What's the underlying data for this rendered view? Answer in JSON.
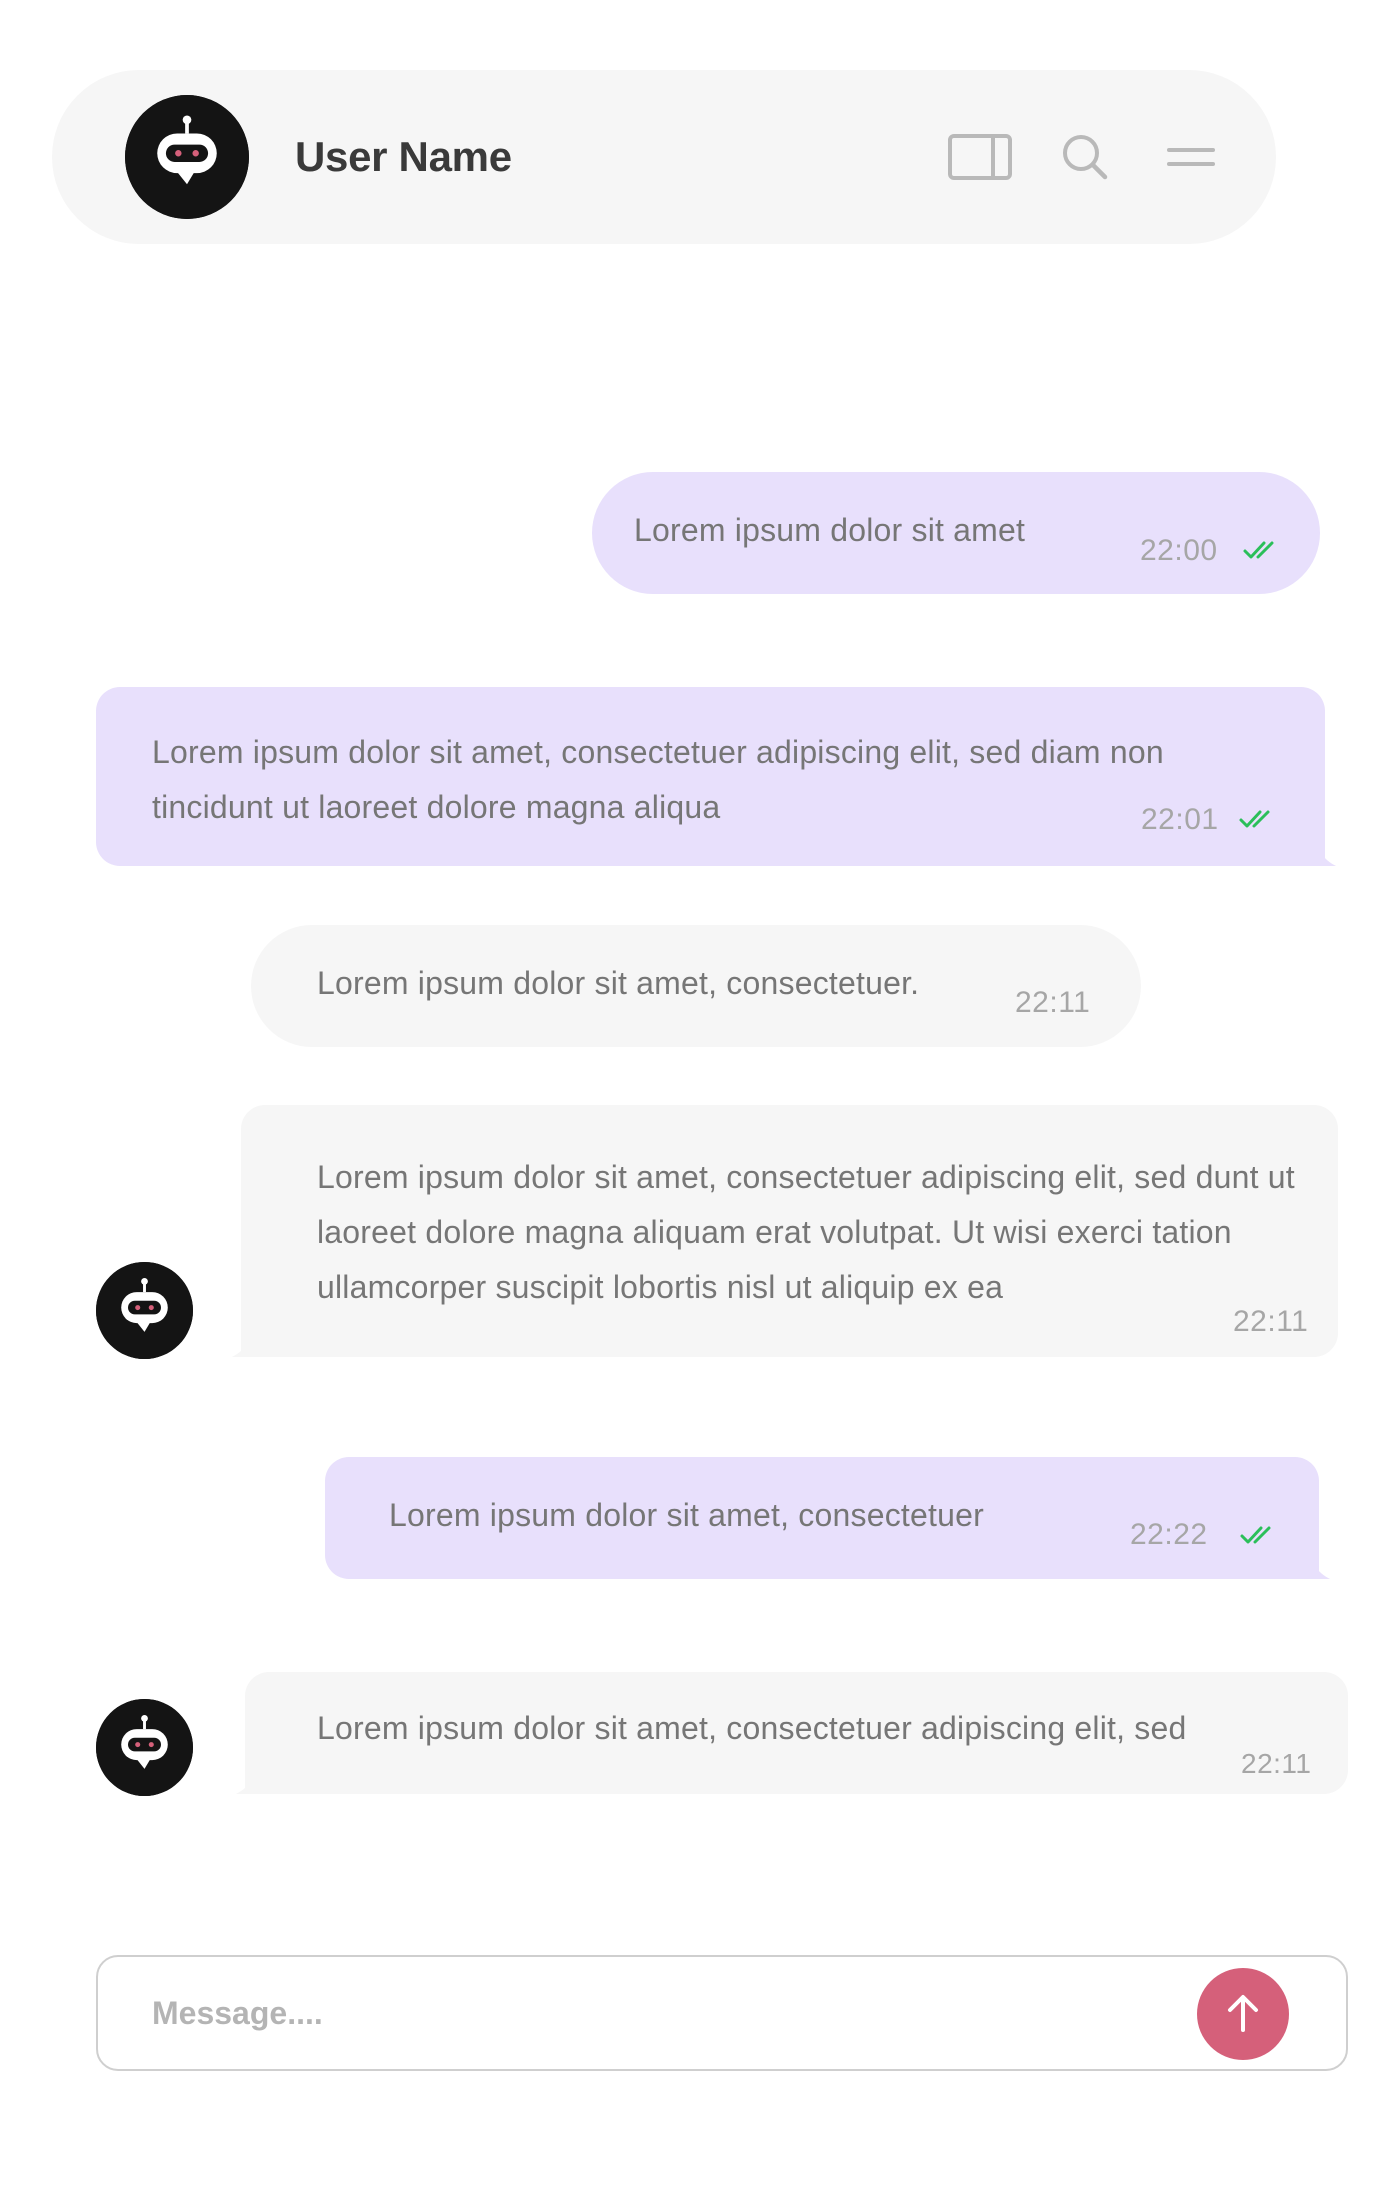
{
  "header": {
    "user_name": "User Name",
    "icons": [
      "bot-avatar-icon",
      "panel-icon",
      "search-icon",
      "menu-icon"
    ]
  },
  "messages": [
    {
      "direction": "outgoing",
      "text": "Lorem ipsum dolor sit amet",
      "time": "22:00",
      "status": "read"
    },
    {
      "direction": "outgoing",
      "text": "Lorem ipsum dolor sit amet, consectetuer adipiscing elit, sed diam non tincidunt ut laoreet dolore magna aliqua",
      "time": "22:01",
      "status": "read"
    },
    {
      "direction": "incoming",
      "text": "Lorem ipsum dolor sit amet, consectetuer.",
      "time": "22:11"
    },
    {
      "direction": "incoming",
      "text": "Lorem ipsum dolor sit amet, consectetuer adipiscing elit, sed dunt ut laoreet dolore magna aliquam erat volutpat. Ut wisi exerci tation ullamcorper suscipit lobortis nisl ut aliquip ex ea",
      "time": "22:11"
    },
    {
      "direction": "outgoing",
      "text": "Lorem ipsum dolor sit amet, consectetuer",
      "time": "22:22",
      "status": "read"
    },
    {
      "direction": "incoming",
      "text": "Lorem ipsum dolor sit amet, consectetuer adipiscing elit, sed",
      "time": "22:11"
    }
  ],
  "composer": {
    "placeholder": "Message....",
    "send_icon": "arrow-up-icon"
  },
  "colors": {
    "outgoing_bubble": "#e8e0fc",
    "incoming_bubble": "#f6f6f6",
    "read_check": "#2bbf5a",
    "send_button": "#d5607a",
    "avatar_bg": "#141414"
  }
}
